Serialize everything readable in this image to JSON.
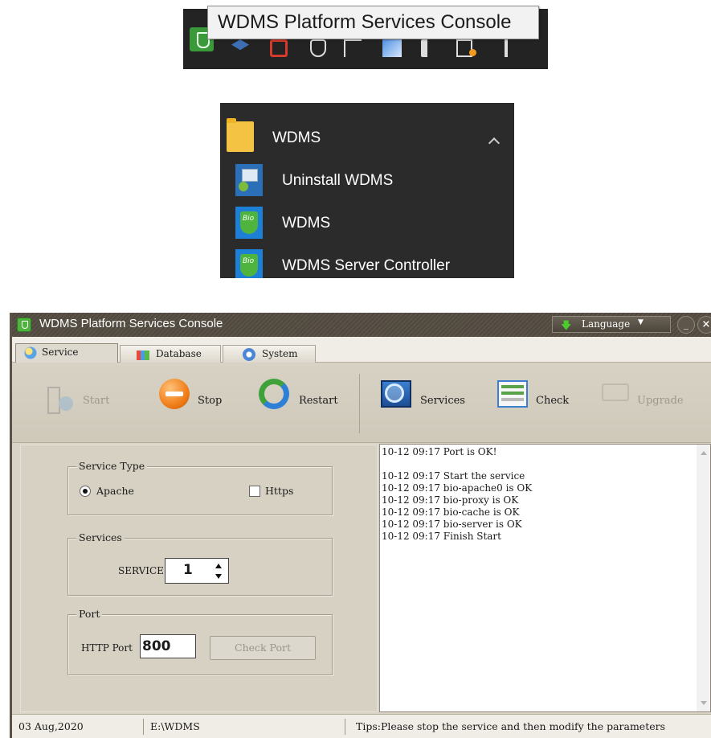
{
  "taskbar": {
    "tooltip": "WDMS Platform Services Console",
    "tray_icons": [
      "wdms-app-icon",
      "dropbox-icon",
      "red-app-icon",
      "security-icon",
      "network-icon",
      "photos-icon",
      "volume-icon",
      "keyboard-icon",
      "input-icon"
    ]
  },
  "start_menu": {
    "folder_label": "WDMS",
    "items": [
      {
        "label": "Uninstall WDMS",
        "icon": "uninstall-icon"
      },
      {
        "label": "WDMS",
        "icon": "wdms-app-icon"
      },
      {
        "label": "WDMS Server Controller",
        "icon": "wdms-app-icon"
      }
    ]
  },
  "window": {
    "title": "WDMS Platform Services Console",
    "language_label": "Language",
    "minimize": "_",
    "close": "×"
  },
  "tabs": [
    {
      "label": "Service",
      "active": true
    },
    {
      "label": "Database",
      "active": false
    },
    {
      "label": "System",
      "active": false
    }
  ],
  "toolbar": {
    "start": "Start",
    "stop": "Stop",
    "restart": "Restart",
    "services": "Services",
    "check": "Check",
    "upgrade": "Upgrade"
  },
  "service_type": {
    "title": "Service Type",
    "apache_label": "Apache",
    "https_label": "Https",
    "apache_selected": true,
    "https_checked": false
  },
  "services": {
    "title": "Services",
    "service_label": "SERVICE",
    "service_value": "1"
  },
  "port": {
    "title": "Port",
    "http_port_label": "HTTP Port",
    "http_port_value": "800",
    "check_port_label": "Check Port"
  },
  "log": {
    "lines": [
      "10-12 09:17 Port is OK!",
      "",
      "10-12 09:17 Start the service",
      "10-12 09:17 bio-apache0 is OK",
      "10-12 09:17 bio-proxy is OK",
      "10-12 09:17 bio-cache is OK",
      "10-12 09:17 bio-server is OK",
      "10-12 09:17 Finish Start"
    ]
  },
  "status_bar": {
    "date": "03 Aug,2020",
    "path": "E:\\WDMS",
    "tips": "Tips:Please stop the service and then modify the parameters"
  },
  "colors": {
    "titlebar": "#5b5348",
    "window_bg": "#d8d3c6",
    "start_menu_bg": "#2b2b2b",
    "taskbar_bg": "#232323",
    "accent_green": "#4fb43e"
  }
}
